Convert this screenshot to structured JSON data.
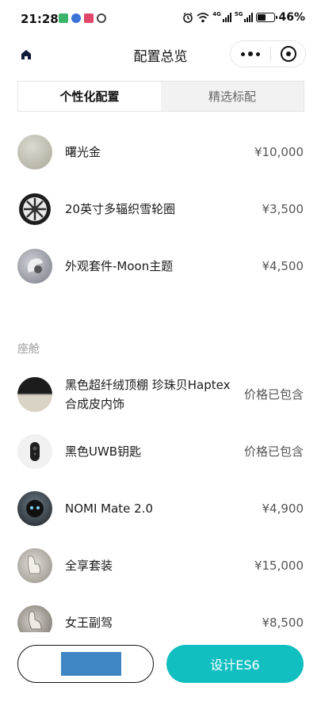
{
  "status_bar": {
    "time": "21:28",
    "network_label_1": "4G",
    "network_label_2": "5G",
    "battery": "46%",
    "battery_level": 0.46
  },
  "nav": {
    "title": "配置总览"
  },
  "tabs": [
    {
      "label": "个性化配置",
      "active": true
    },
    {
      "label": "精选标配",
      "active": false
    }
  ],
  "exterior_items": [
    {
      "name": "曙光金",
      "price": "¥10,000",
      "icon": "color-swatch-icon"
    },
    {
      "name": "20英寸多辐织雪轮圈",
      "price": "¥3,500",
      "icon": "wheel-icon"
    },
    {
      "name": "外观套件-Moon主题",
      "price": "¥4,500",
      "icon": "exterior-kit-icon"
    }
  ],
  "cabin": {
    "section_title": "座舱",
    "items": [
      {
        "name_line1": "黑色超纤绒顶棚 珍珠贝Haptex",
        "name_line2": "合成皮内饰",
        "price": "价格已包含",
        "icon": "interior-color-icon"
      },
      {
        "name": "黑色UWB钥匙",
        "price": "价格已包含",
        "icon": "key-fob-icon"
      },
      {
        "name": "NOMI Mate 2.0",
        "price": "¥4,900",
        "icon": "nomi-icon"
      },
      {
        "name": "全享套装",
        "price": "¥15,000",
        "icon": "seat-package-icon"
      },
      {
        "name": "女王副驾",
        "price": "¥8,500",
        "icon": "passenger-seat-icon"
      }
    ]
  },
  "bottom": {
    "design_button": "设计ES6"
  }
}
